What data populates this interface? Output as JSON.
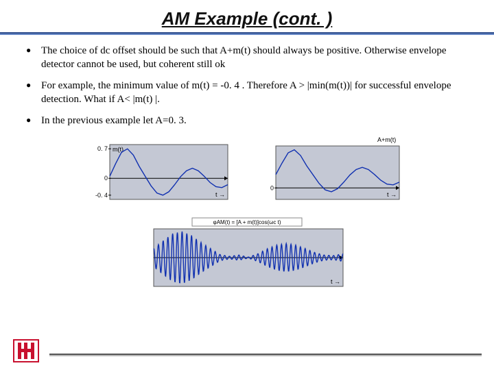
{
  "title": "AM Example (cont. )",
  "bullets": {
    "b1": "The choice of dc offset  should be such that A+m(t) should always be positive. Otherwise envelope detector cannot be used, but coherent still ok",
    "b2": " For example, the minimum value of m(t) = -0. 4 . Therefore A > |min(m(t))| for successful envelope detection. What if A< |m(t) |.",
    "b3": "In the previous example let A=0. 3."
  },
  "chart_data": [
    {
      "type": "line",
      "title": "m(t)",
      "xlabel": "t →",
      "ylabel": "",
      "ylim": [
        -0.5,
        0.8
      ],
      "yticks": [
        -0.4,
        0,
        0.7
      ],
      "series": [
        {
          "name": "m(t)",
          "color": "#1030b0",
          "x": [
            0,
            1,
            2,
            3,
            4,
            5,
            6,
            7,
            8,
            9,
            10,
            11,
            12,
            13,
            14,
            15,
            16,
            17,
            18,
            19,
            20
          ],
          "values": [
            0.05,
            0.35,
            0.62,
            0.7,
            0.55,
            0.28,
            0.05,
            -0.18,
            -0.35,
            -0.4,
            -0.32,
            -0.15,
            0.04,
            0.18,
            0.24,
            0.18,
            0.05,
            -0.1,
            -0.2,
            -0.22,
            -0.15
          ]
        }
      ]
    },
    {
      "type": "line",
      "title": "A+m(t)",
      "xlabel": "t →",
      "ylabel": "",
      "ylim": [
        -0.3,
        1.1
      ],
      "yticks": [
        0
      ],
      "series": [
        {
          "name": "A+m(t)",
          "color": "#1030b0",
          "x": [
            0,
            1,
            2,
            3,
            4,
            5,
            6,
            7,
            8,
            9,
            10,
            11,
            12,
            13,
            14,
            15,
            16,
            17,
            18,
            19,
            20
          ],
          "values": [
            0.35,
            0.65,
            0.92,
            1.0,
            0.85,
            0.58,
            0.35,
            0.12,
            -0.05,
            -0.1,
            -0.02,
            0.15,
            0.34,
            0.48,
            0.54,
            0.48,
            0.35,
            0.2,
            0.1,
            0.08,
            0.15
          ]
        }
      ]
    },
    {
      "type": "line",
      "title": "φ_AM(t) = [A + m(t)]cos(ω_c t)",
      "xlabel": "t →",
      "ylabel": "",
      "ylim": [
        -1.1,
        1.1
      ],
      "series": [
        {
          "name": "φ_AM(t)",
          "color": "#1030b0",
          "envelope_x": [
            0,
            1,
            2,
            3,
            4,
            5,
            6,
            7,
            8,
            9,
            10,
            11,
            12,
            13,
            14,
            15,
            16,
            17,
            18,
            19,
            20
          ],
          "envelope_values": [
            0.35,
            0.65,
            0.92,
            1.0,
            0.85,
            0.58,
            0.35,
            0.12,
            0.05,
            0.1,
            0.02,
            0.15,
            0.34,
            0.48,
            0.54,
            0.48,
            0.35,
            0.2,
            0.1,
            0.08,
            0.15
          ],
          "carrier_cycles": 40
        }
      ]
    }
  ]
}
